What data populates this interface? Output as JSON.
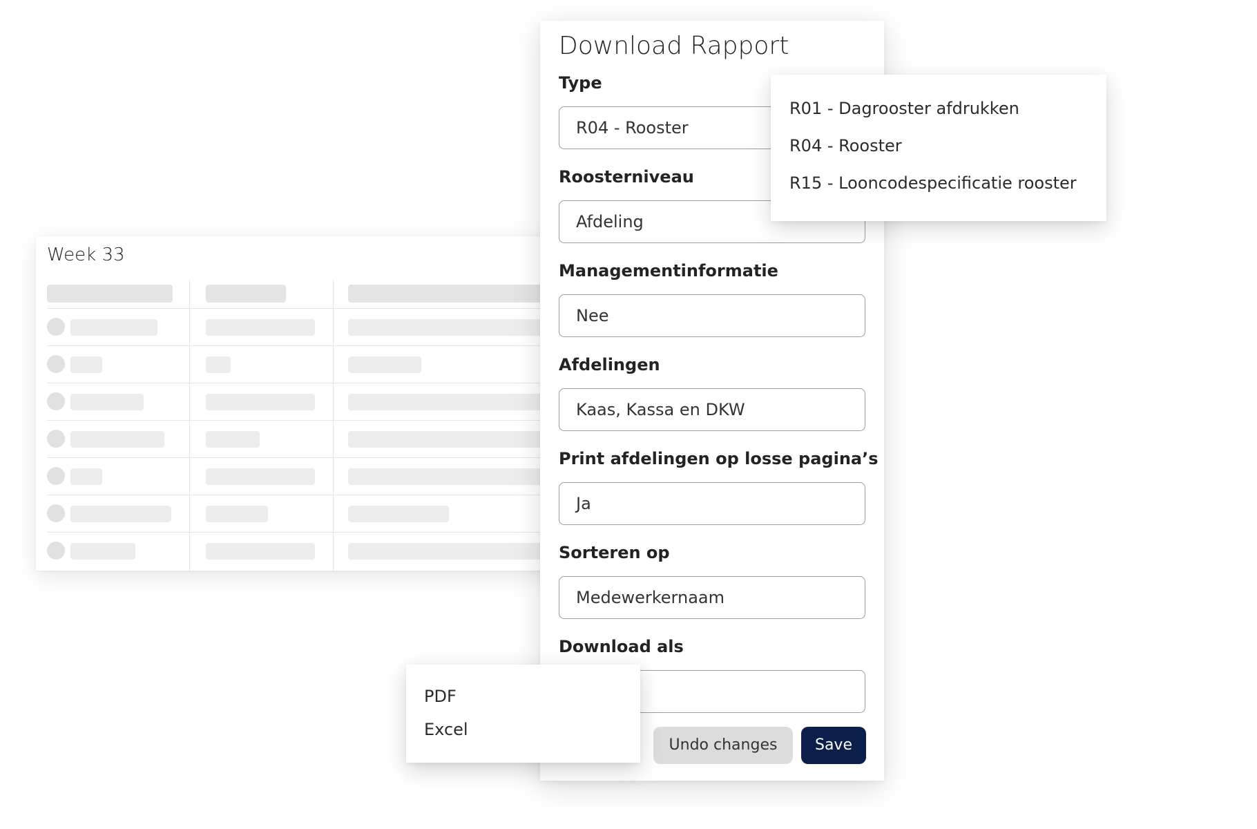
{
  "week_table": {
    "title": "Week 33"
  },
  "dialog": {
    "title": "Download Rapport",
    "fields": [
      {
        "label": "Type",
        "value": "R04 - Rooster"
      },
      {
        "label": "Roosterniveau",
        "value": "Afdeling"
      },
      {
        "label": "Managementinformatie",
        "value": "Nee"
      },
      {
        "label": "Afdelingen",
        "value": "Kaas, Kassa en DKW"
      },
      {
        "label": "Print afdelingen op losse pagina’s",
        "value": "Ja"
      },
      {
        "label": "Sorteren op",
        "value": "Medewerkernaam"
      },
      {
        "label": "Download als",
        "value": ""
      }
    ],
    "undo_label": "Undo changes",
    "save_label": "Save"
  },
  "type_menu": {
    "options": [
      "R01 - Dagrooster afdrukken",
      "R04 - Rooster",
      "R15 - Looncodespecificatie rooster"
    ]
  },
  "format_menu": {
    "options": [
      "PDF",
      "Excel"
    ]
  },
  "colors": {
    "primary": "#0c1f4a",
    "secondary_button": "#dcdcdc",
    "field_border": "#9d9d9d",
    "skeleton": "#ececec"
  }
}
